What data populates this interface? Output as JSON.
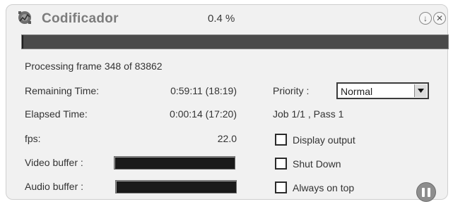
{
  "window": {
    "title": "Codificador",
    "percent_label": "0.4 %",
    "progress_fraction": 0.004,
    "app_icon": "codificador-app-icon",
    "minimize_icon": "arrow-down-circle-icon",
    "close_icon": "close-circle-icon"
  },
  "status": {
    "processing": "Processing frame 348 of 83862"
  },
  "stats": {
    "remaining_label": "Remaining Time:",
    "remaining_value": "0:59:11 (18:19)",
    "elapsed_label": "Elapsed Time:",
    "elapsed_value": "0:00:14 (17:20)",
    "fps_label": "fps:",
    "fps_value": "22.0",
    "video_buffer_label": "Video buffer :",
    "audio_buffer_label": "Audio buffer :"
  },
  "priority": {
    "label": "Priority :",
    "selected": "Normal"
  },
  "job": {
    "text": "Job 1/1 , Pass 1"
  },
  "options": {
    "display_output": "Display output",
    "display_output_checked": false,
    "shut_down": "Shut Down",
    "shut_down_checked": false,
    "always_on_top": "Always on top",
    "always_on_top_checked": false
  },
  "controls": {
    "pause_icon": "pause-icon"
  }
}
